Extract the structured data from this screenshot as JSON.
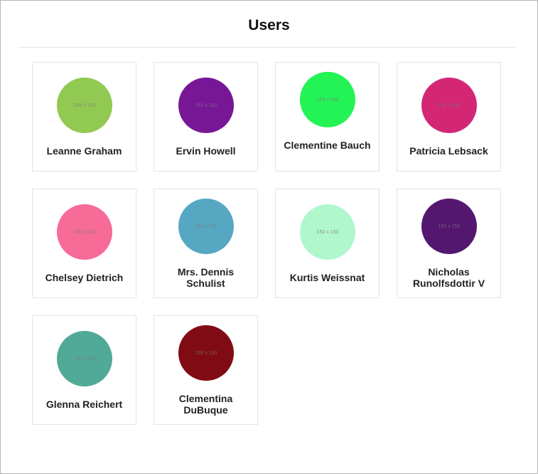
{
  "page": {
    "title": "Users"
  },
  "users": [
    {
      "name": "Leanne Graham",
      "avatar_text": "150 x 150",
      "avatar_color": "#92c952"
    },
    {
      "name": "Ervin Howell",
      "avatar_text": "150 x 150",
      "avatar_color": "#771796"
    },
    {
      "name": "Clementine Bauch",
      "avatar_text": "150 x 150",
      "avatar_color": "#24f355"
    },
    {
      "name": "Patricia Lebsack",
      "avatar_text": "150 x 150",
      "avatar_color": "#d32776"
    },
    {
      "name": "Chelsey Dietrich",
      "avatar_text": "150 x 150",
      "avatar_color": "#f66b97"
    },
    {
      "name": "Mrs. Dennis Schulist",
      "avatar_text": "150 x 150",
      "avatar_color": "#56a8c2"
    },
    {
      "name": "Kurtis Weissnat",
      "avatar_text": "150 x 150",
      "avatar_color": "#b0f7cc"
    },
    {
      "name": "Nicholas Runolfsdottir V",
      "avatar_text": "150 x 150",
      "avatar_color": "#54176f"
    },
    {
      "name": "Glenna Reichert",
      "avatar_text": "150 x 150",
      "avatar_color": "#51aa97"
    },
    {
      "name": "Clementina DuBuque",
      "avatar_text": "150 x 150",
      "avatar_color": "#810b14"
    }
  ]
}
